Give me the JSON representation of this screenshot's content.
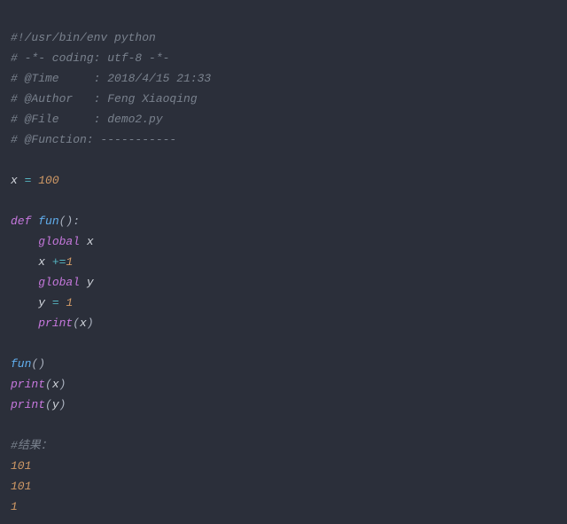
{
  "comments": {
    "shebang": "#!/usr/bin/env python",
    "coding": "# -*- coding: utf-8 -*-",
    "time": "# @Time     : 2018/4/15 21:33",
    "author": "# @Author   : Feng Xiaoqing",
    "file": "# @File     : demo2.py",
    "func": "# @Function: -----------",
    "result": "#结果："
  },
  "code": {
    "x_eq": "x ",
    "eq": "= ",
    "n100": "100",
    "def": "def ",
    "fun_name": "fun",
    "parens_colon": "():",
    "indent": "    ",
    "global": "global ",
    "x": "x",
    "y": "y",
    "x_pluseq": "x ",
    "pluseq": "+=",
    "one": "1",
    "y_eq": "y ",
    "print": "print",
    "lpar": "(",
    "rpar": ")",
    "fun_call": "fun",
    "call_parens": "()"
  },
  "output": {
    "l1": "101",
    "l2": "101",
    "l3": "1"
  }
}
